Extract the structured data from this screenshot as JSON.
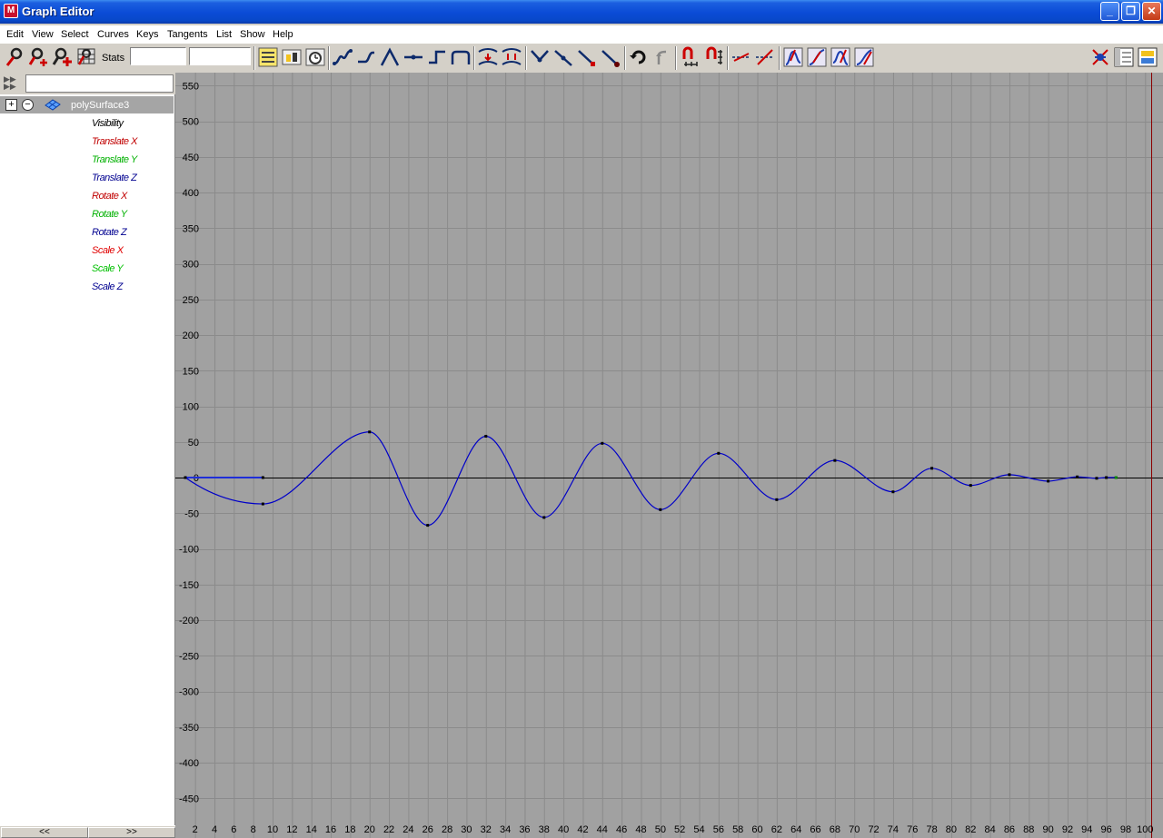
{
  "window": {
    "title": "Graph Editor",
    "app_icon": "maya-icon",
    "controls": [
      "minimize-icon",
      "restore-icon",
      "close-icon"
    ]
  },
  "menu": [
    "Edit",
    "View",
    "Select",
    "Curves",
    "Keys",
    "Tangents",
    "List",
    "Show",
    "Help"
  ],
  "toolbar": {
    "stats_label": "Stats",
    "stats_value_1": "",
    "stats_value_2": "",
    "icons": [
      "move-nearest-key-icon",
      "insert-key-icon",
      "add-key-icon",
      "lattice-deform-icon",
      "frame-all-icon",
      "frame-selection-icon",
      "frame-playback-range-icon",
      "spline-tangent-icon",
      "clamped-tangent-icon",
      "linear-tangent-icon",
      "flat-tangent-icon",
      "step-tangent-icon",
      "plateau-tangent-icon",
      "buffer-curve-snapshot-icon",
      "swap-buffer-curve-icon",
      "break-tangents-icon",
      "unify-tangents-icon",
      "free-tangent-weight-icon",
      "lock-tangent-weight-icon",
      "auto-load-icon",
      "load-selection-icon",
      "time-snap-icon",
      "value-snap-icon",
      "normalize-icon",
      "denormalize-icon",
      "pre-infinity-cycle-icon",
      "pre-infinity-offset-icon",
      "post-infinity-cycle-icon",
      "post-infinity-offset-icon",
      "dope-sheet-icon",
      "trax-editor-icon",
      "channel-box-icon"
    ]
  },
  "outliner": {
    "filter_value": "",
    "node": "polySurface3",
    "attributes": [
      {
        "label": "Visibility",
        "color": "#000000"
      },
      {
        "label": "Translate X",
        "color": "#c00000"
      },
      {
        "label": "Translate Y",
        "color": "#00b000"
      },
      {
        "label": "Translate Z",
        "color": "#000090"
      },
      {
        "label": "Rotate X",
        "color": "#c00000"
      },
      {
        "label": "Rotate Y",
        "color": "#00b000"
      },
      {
        "label": "Rotate Z",
        "color": "#000090"
      },
      {
        "label": "Scale X",
        "color": "#e00000"
      },
      {
        "label": "Scale Y",
        "color": "#00c000"
      },
      {
        "label": "Scale Z",
        "color": "#000090"
      }
    ],
    "scroll_left": "<<",
    "scroll_right": ">>"
  },
  "graph": {
    "y_ticks": [
      "550",
      "500",
      "450",
      "400",
      "350",
      "300",
      "250",
      "200",
      "150",
      "100",
      "50",
      "0",
      "-50",
      "-100",
      "-150",
      "-200",
      "-250",
      "-300",
      "-350",
      "-400",
      "-450"
    ],
    "x_ticks": [
      "2",
      "4",
      "6",
      "8",
      "10",
      "12",
      "14",
      "16",
      "18",
      "20",
      "22",
      "24",
      "26",
      "28",
      "30",
      "32",
      "34",
      "36",
      "38",
      "40",
      "42",
      "44",
      "46",
      "48",
      "50",
      "52",
      "54",
      "56",
      "58",
      "60",
      "62",
      "64",
      "66",
      "68",
      "70",
      "72",
      "74",
      "76",
      "78",
      "80",
      "82",
      "84",
      "86",
      "88",
      "90",
      "92",
      "94",
      "96",
      "98",
      "100"
    ],
    "curve_color": "#0000c8",
    "background": "#a1a1a1",
    "keys": [
      {
        "frame": 1,
        "value": 0
      },
      {
        "frame": 9,
        "value": -37
      },
      {
        "frame": 20,
        "value": 64
      },
      {
        "frame": 26,
        "value": -67
      },
      {
        "frame": 32,
        "value": 58
      },
      {
        "frame": 38,
        "value": -56
      },
      {
        "frame": 44,
        "value": 48
      },
      {
        "frame": 50,
        "value": -45
      },
      {
        "frame": 56,
        "value": 34
      },
      {
        "frame": 62,
        "value": -31
      },
      {
        "frame": 68,
        "value": 24
      },
      {
        "frame": 74,
        "value": -20
      },
      {
        "frame": 78,
        "value": 13
      },
      {
        "frame": 82,
        "value": -11
      },
      {
        "frame": 86,
        "value": 4
      },
      {
        "frame": 90,
        "value": -5
      },
      {
        "frame": 93,
        "value": 1
      },
      {
        "frame": 95,
        "value": -1
      },
      {
        "frame": 96,
        "value": 0
      },
      {
        "frame": 97,
        "value": 0
      }
    ],
    "flat_segment": {
      "from_frame": 1,
      "to_frame": 9,
      "value": 0
    }
  }
}
